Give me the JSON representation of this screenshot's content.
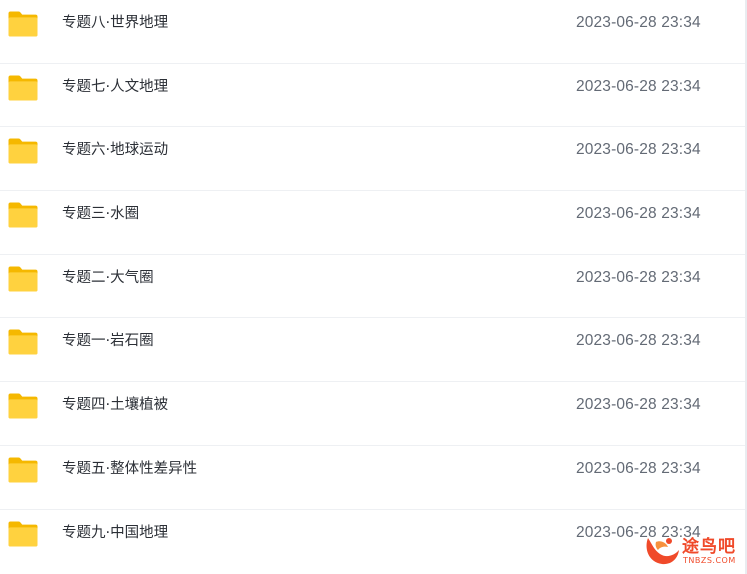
{
  "files": [
    {
      "name": "专题八·世界地理",
      "modified": "2023-06-28 23:34",
      "icon": "folder-icon"
    },
    {
      "name": "专题七·人文地理",
      "modified": "2023-06-28 23:34",
      "icon": "folder-icon"
    },
    {
      "name": "专题六·地球运动",
      "modified": "2023-06-28 23:34",
      "icon": "folder-icon"
    },
    {
      "name": "专题三·水圈",
      "modified": "2023-06-28 23:34",
      "icon": "folder-icon"
    },
    {
      "name": "专题二·大气圈",
      "modified": "2023-06-28 23:34",
      "icon": "folder-icon"
    },
    {
      "name": "专题一·岩石圈",
      "modified": "2023-06-28 23:34",
      "icon": "folder-icon"
    },
    {
      "name": "专题四·土壤植被",
      "modified": "2023-06-28 23:34",
      "icon": "folder-icon"
    },
    {
      "name": "专题五·整体性差异性",
      "modified": "2023-06-28 23:34",
      "icon": "folder-icon"
    },
    {
      "name": "专题九·中国地理",
      "modified": "2023-06-28 23:34",
      "icon": "folder-icon"
    }
  ],
  "watermark": {
    "text": "途鸟吧",
    "subtext": "TNBZS.COM"
  },
  "colors": {
    "folder_back": "#f5b800",
    "folder_front": "#ffd23f",
    "name_text": "#2b2f36",
    "date_text": "#636a75",
    "divider": "#eef0f3",
    "watermark": "#f04a2a"
  }
}
